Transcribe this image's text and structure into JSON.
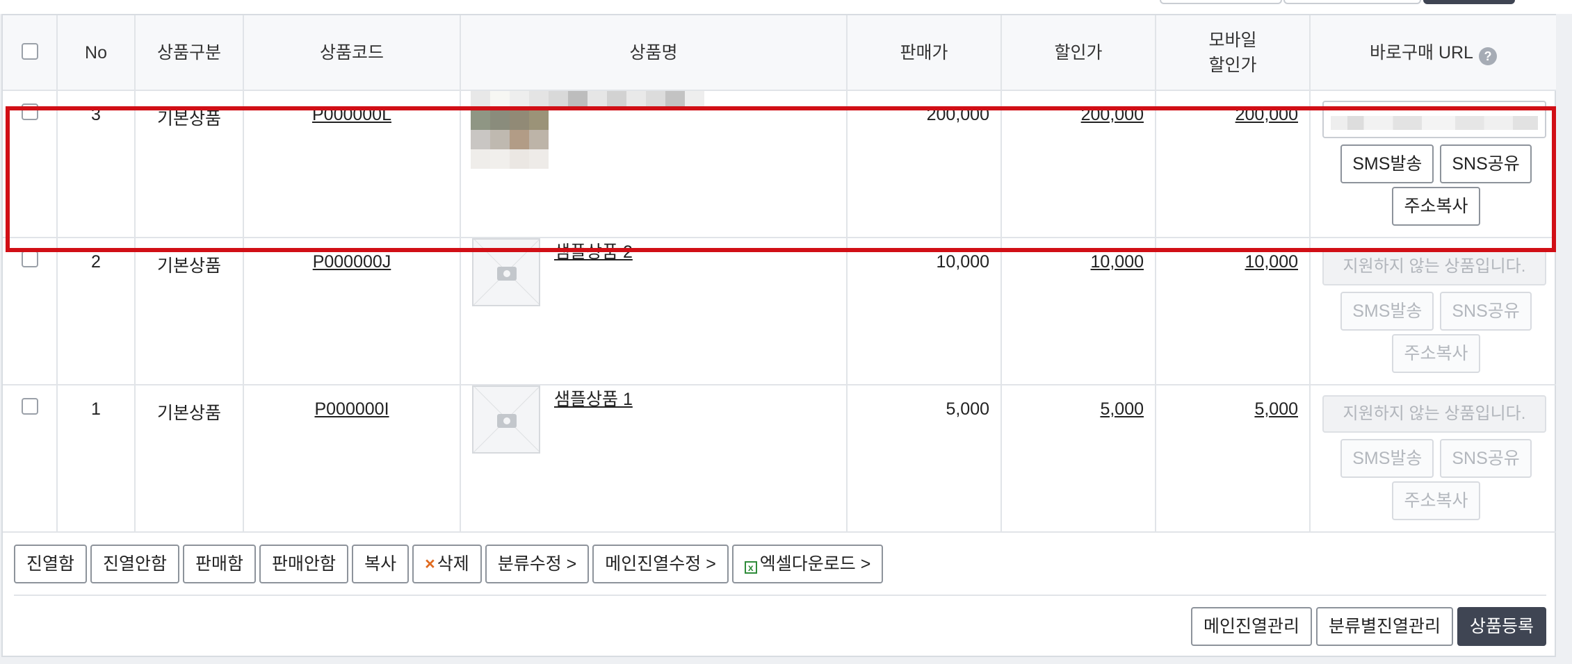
{
  "table": {
    "headers": {
      "no": "No",
      "type": "상품구분",
      "code": "상품코드",
      "name": "상품명",
      "price": "판매가",
      "discount": "할인가",
      "mobile_discount_line1": "모바일",
      "mobile_discount_line2": "할인가",
      "buy_url": "바로구매 URL",
      "help_icon": "?"
    },
    "rows": [
      {
        "no": "3",
        "type": "기본상품",
        "code": "P000000L",
        "name": "",
        "price": "200,000",
        "discount": "200,000",
        "mobile_discount": "200,000",
        "url_value": "",
        "url_supported": true,
        "sms": "SMS발송",
        "sns": "SNS공유",
        "copy": "주소복사",
        "selected_highlight": true
      },
      {
        "no": "2",
        "type": "기본상품",
        "code": "P000000J",
        "name": "샘플상품 2",
        "price": "10,000",
        "discount": "10,000",
        "mobile_discount": "10,000",
        "url_value": "지원하지 않는 상품입니다.",
        "url_supported": false,
        "sms": "SMS발송",
        "sns": "SNS공유",
        "copy": "주소복사"
      },
      {
        "no": "1",
        "type": "기본상품",
        "code": "P000000I",
        "name": "샘플상품 1",
        "price": "5,000",
        "discount": "5,000",
        "mobile_discount": "5,000",
        "url_value": "지원하지 않는 상품입니다.",
        "url_supported": false,
        "sms": "SMS발송",
        "sns": "SNS공유",
        "copy": "주소복사"
      }
    ]
  },
  "actions": {
    "display_on": "진열함",
    "display_off": "진열안함",
    "sell_on": "판매함",
    "sell_off": "판매안함",
    "copy": "복사",
    "delete": "삭제",
    "delete_icon": "×",
    "category_edit": "분류수정 >",
    "main_display_edit": "메인진열수정 >",
    "excel_download": "엑셀다운로드 >",
    "excel_icon": "x"
  },
  "bottom": {
    "main_display_manage": "메인진열관리",
    "category_display_manage": "분류별진열관리",
    "register_product": "상품등록"
  },
  "colors": {
    "highlight_border": "#d10f16",
    "primary_dark": "#3f4553",
    "delete_icon": "#e06a1f",
    "excel_icon": "#2f8c3a"
  }
}
